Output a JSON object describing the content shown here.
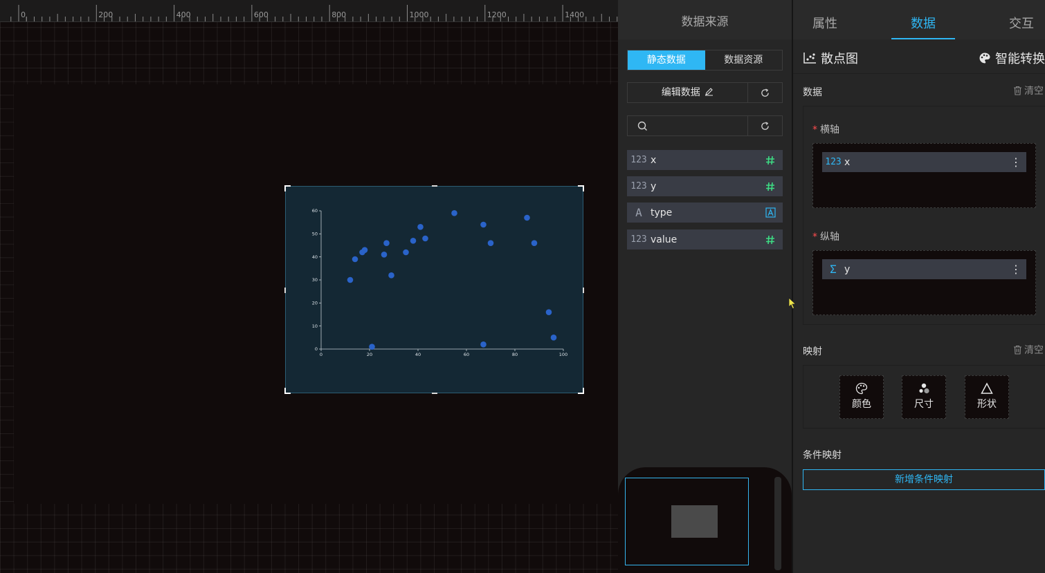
{
  "ruler": {
    "labels": [
      "0",
      "200",
      "400",
      "600",
      "800",
      "1000",
      "1200",
      "1400"
    ]
  },
  "data_source": {
    "title": "数据来源",
    "toggle": [
      "静态数据",
      "数据资源"
    ],
    "edit_label": "编辑数据",
    "search_placeholder": "",
    "fields": [
      {
        "icon": "123",
        "name": "x",
        "type_icon": "hash-icon"
      },
      {
        "icon": "123",
        "name": "y",
        "type_icon": "hash-icon"
      },
      {
        "icon": "A",
        "name": "type",
        "type_icon": "text-type-icon"
      },
      {
        "icon": "123",
        "name": "value",
        "type_icon": "hash-icon"
      }
    ]
  },
  "tabs": [
    "属性",
    "数据",
    "交互"
  ],
  "chart_type": "散点图",
  "smart_convert": "智能转换",
  "data_section": {
    "title": "数据",
    "clear": "清空",
    "x_axis_label": "横轴",
    "x_field": {
      "icon": "123",
      "name": "x"
    },
    "y_axis_label": "纵轴",
    "y_field": {
      "icon": "Σ",
      "name": "y"
    }
  },
  "mapping": {
    "title": "映射",
    "clear": "清空",
    "buttons": [
      "颜色",
      "尺寸",
      "形状"
    ]
  },
  "conditional": {
    "title": "条件映射",
    "add_label": "新增条件映射"
  },
  "colors": {
    "accent": "#2fb7f4",
    "point": "#2a63c9",
    "chart_bg": "#142834",
    "hash": "#3ddc84"
  },
  "chart_data": {
    "type": "scatter",
    "x": [
      12,
      14,
      17,
      18,
      21,
      26,
      27,
      29,
      35,
      38,
      41,
      43,
      55,
      67,
      67,
      70,
      85,
      88,
      94,
      96
    ],
    "y": [
      30,
      39,
      42,
      43,
      1,
      41,
      46,
      32,
      42,
      47,
      53,
      48,
      59,
      54,
      2,
      46,
      57,
      46,
      16,
      5
    ],
    "xlim": [
      0,
      100
    ],
    "ylim": [
      0,
      60
    ],
    "xticks": [
      "0",
      "20",
      "40",
      "60",
      "80",
      "100"
    ],
    "yticks": [
      "0",
      "10",
      "20",
      "30",
      "40",
      "50",
      "60"
    ],
    "title": "",
    "xlabel": "",
    "ylabel": "",
    "grid": false
  }
}
